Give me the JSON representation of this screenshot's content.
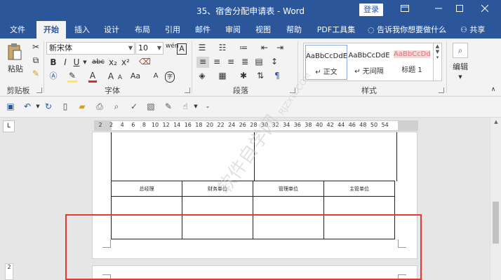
{
  "titlebar": {
    "title": "35、宿舍分配申请表 - Word",
    "login": "登录",
    "ribbon_display_icon": "ribbon-display-options-icon",
    "minimize_icon": "minimize-icon",
    "maximize_icon": "maximize-icon",
    "close_icon": "close-icon"
  },
  "tabs": [
    "文件",
    "开始",
    "插入",
    "设计",
    "布局",
    "引用",
    "邮件",
    "审阅",
    "视图",
    "帮助",
    "PDF工具集"
  ],
  "active_tab": "开始",
  "tell_me": "告诉我你想要做什么",
  "share": "共享",
  "ribbon": {
    "clipboard": {
      "paste": "粘贴",
      "label": "剪贴板"
    },
    "font": {
      "font_name": "新宋体",
      "font_size": "10",
      "label": "字体",
      "wen_glyph": "wén",
      "grow": "A",
      "shrink": "A",
      "aa": "Aa",
      "bold": "B",
      "italic": "I",
      "underline": "U",
      "strike": "abc",
      "sub": "x₂",
      "sup": "x²",
      "font_color": "A",
      "char_border": "A",
      "enclose": "字"
    },
    "paragraph": {
      "label": "段落"
    },
    "styles": {
      "label": "样式",
      "items": [
        {
          "preview": "AaBbCcDdE",
          "name": "正文"
        },
        {
          "preview": "AaBbCcDdE",
          "name": "无间隔"
        },
        {
          "preview": "AaBbCcDd",
          "name": "标题 1"
        }
      ]
    },
    "editing": {
      "label": "编辑"
    }
  },
  "ruler": {
    "ticks": [
      "2",
      "2",
      "4",
      "6",
      "8",
      "10",
      "12",
      "14",
      "16",
      "18",
      "20",
      "22",
      "24",
      "26",
      "28",
      "30",
      "32",
      "34",
      "36",
      "38",
      "40",
      "42",
      "44",
      "46",
      "48",
      "50",
      "54"
    ]
  },
  "table": {
    "headers": [
      "总经理",
      "财务单位",
      "管理单位",
      "主管单位"
    ]
  },
  "watermark": {
    "text": "软件自学网",
    "url": "RJZXW.COM"
  },
  "page_indicator": "2",
  "tab_selector": "L",
  "colors": {
    "word_blue": "#2b579a",
    "highlight_red": "#e53935"
  }
}
